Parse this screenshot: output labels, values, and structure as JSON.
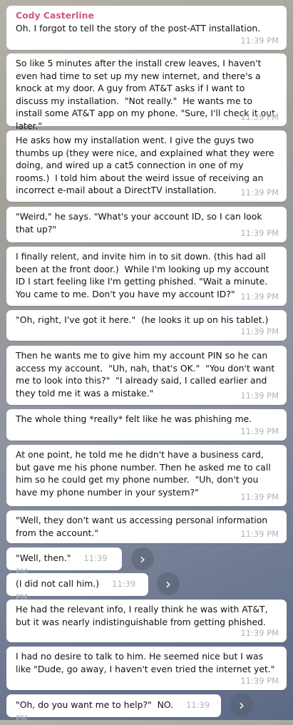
{
  "author": "Cody Casterline",
  "time": "11:39 PM",
  "messages": [
    "Oh. I forgot to tell the story of the post-ATT installation.",
    "So like 5 minutes after the install crew leaves, I haven't even had time to set up my new internet, and there's a knock at my door. A guy from AT&T asks if I want to discuss my installation.  \"Not really.\"  He wants me to install some AT&T app on my phone. \"Sure, I'll check it out later.\"",
    "He asks how my installation went. I give the guys two thumbs up (they were nice, and explained what they were doing, and wired up a cat5 connection in one of my rooms.)  I told him about the weird issue of receiving an incorrect e-mail about a DirectTV installation.",
    "\"Weird,\" he says. \"What's your account ID, so I can look that up?\"",
    "I finally relent, and invite him in to sit down. (this had all been at the front door.)  While I'm looking up my account ID I start feeling like I'm getting phished. \"Wait a minute. You came to me. Don't you have my account ID?\"",
    "\"Oh, right, I've got it here.\"  (he looks it up on his tablet.)",
    "Then he wants me to give him my account PIN so he can access my account.  \"Uh, nah, that's OK.\"  \"You don't want me to look into this?\"  \"I already said, I called earlier and they told me it was a mistake.\"",
    "The whole thing *really* felt like he was phishing me.",
    "At one point, he told me he didn't have a business card, but gave me his phone number. Then he asked me to call him so he could get my phone number.  \"Uh, don't you have my phone number in your system?\"",
    "\"Well, they don't want us accessing personal information from the account.\"",
    "\"Well, then.\"",
    "(I did not call him.)",
    "He had the relevant info, I really think he was with AT&T, but it was nearly indistinguishable from getting phished.",
    "I had no desire to talk to him. He seemed nice but I was like \"Dude, go away, I haven't even tried the internet yet.\"",
    "\"Oh, do you want me to help?\"  NO."
  ],
  "share_icon": "chevron-right-icon"
}
